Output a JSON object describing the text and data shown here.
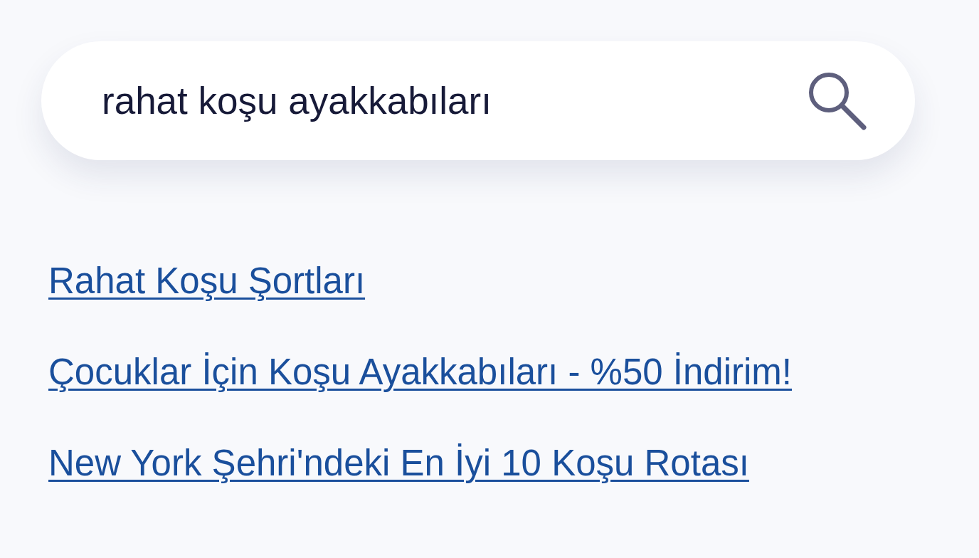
{
  "search": {
    "value": "rahat koşu ayakkabıları"
  },
  "suggestions": [
    {
      "label": "Rahat Koşu Şortları"
    },
    {
      "label": "Çocuklar İçin Koşu Ayakkabıları - %50 İndirim!"
    },
    {
      "label": "New York Şehri'ndeki En İyi 10 Koşu Rotası"
    }
  ]
}
